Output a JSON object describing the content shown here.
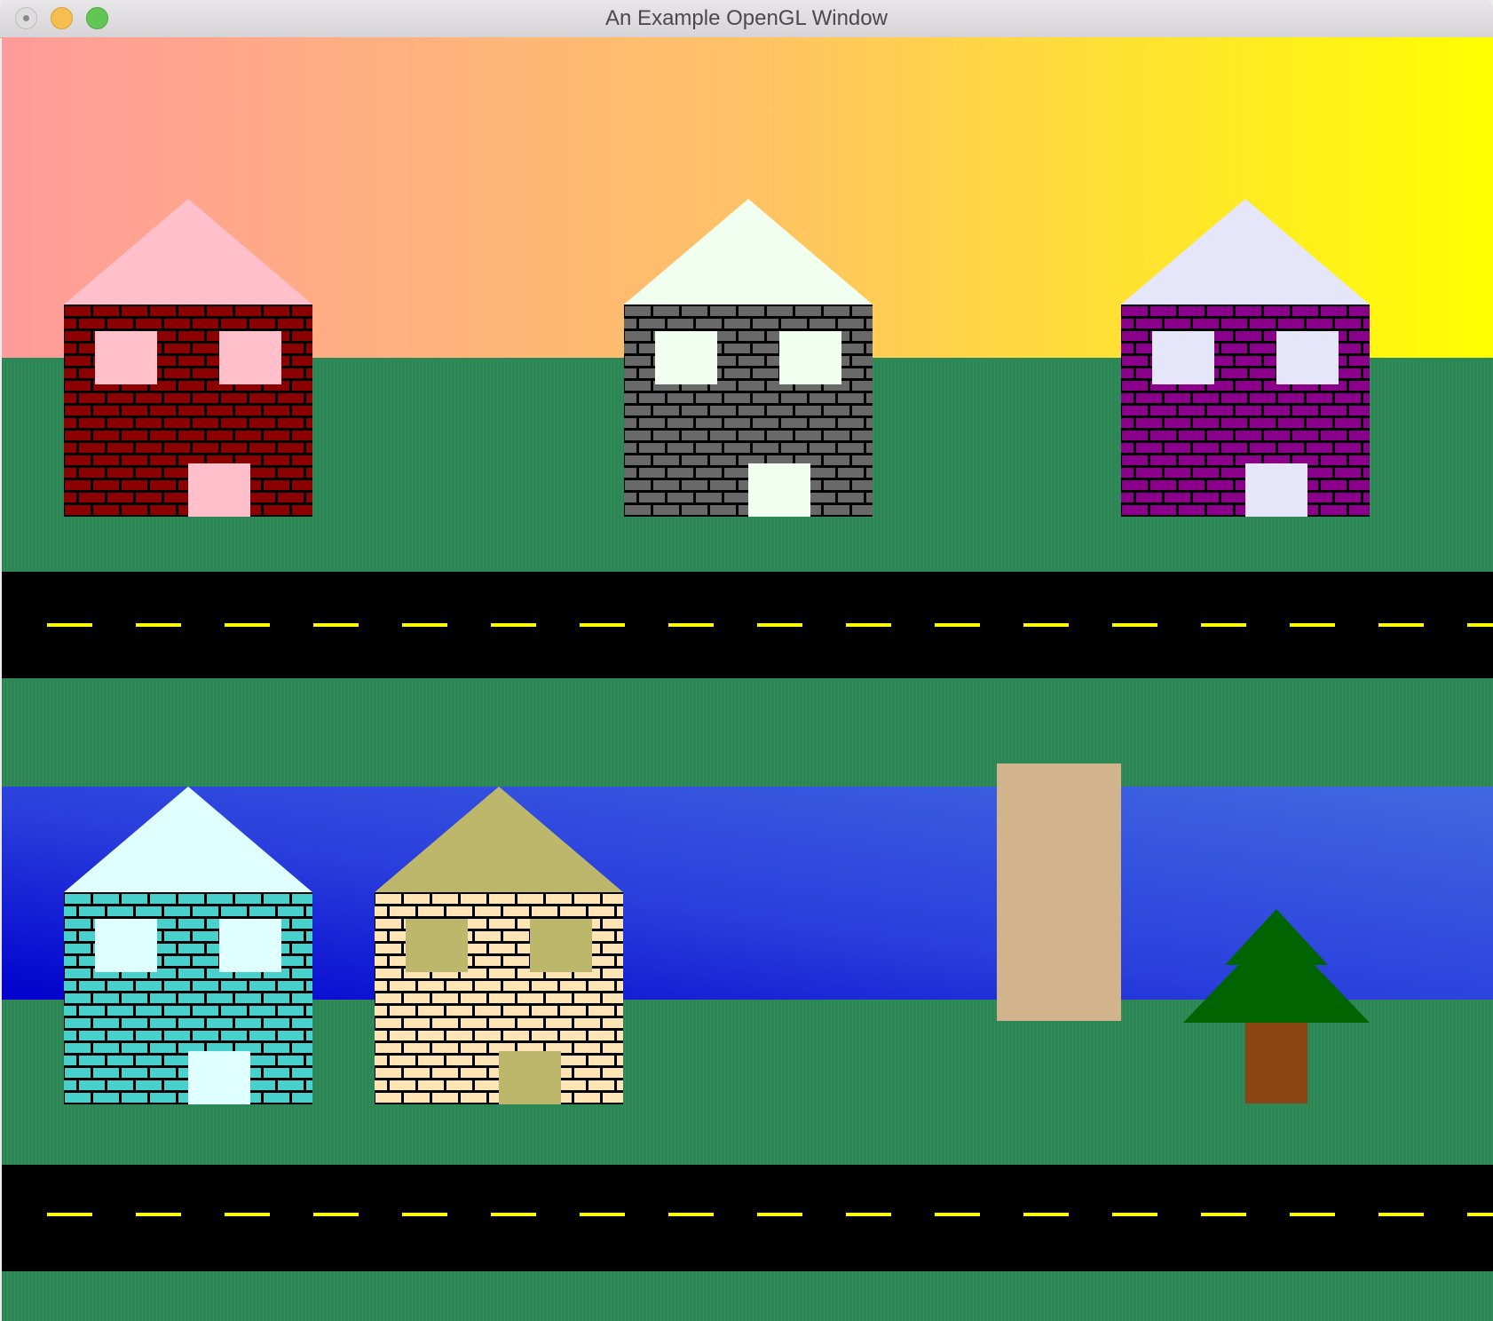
{
  "window": {
    "title": "An Example OpenGL Window"
  },
  "icons": [
    "close-button-icon",
    "minimize-button-icon",
    "zoom-button-icon"
  ],
  "colors": {
    "sky_left": "#ff9b9b",
    "sky_mid": "#ffc266",
    "sky_right": "#ffff00",
    "grass": "#2e8b57",
    "road": "#000000",
    "lane_line": "#ffff00",
    "river_left": "#0000cd",
    "river_mid": "#2a3fdc",
    "river_right": "#4169e1",
    "bridge": "#d2b48c",
    "tree_foliage": "#006400",
    "tree_trunk": "#8b4513"
  },
  "scene": {
    "houses": [
      {
        "name": "house-red",
        "wall": "#8b0000",
        "mortar": "#000000",
        "roof": "#ffc0cb",
        "trim": "#ffc0cb"
      },
      {
        "name": "house-gray",
        "wall": "#696969",
        "mortar": "#000000",
        "roof": "#f0fff0",
        "trim": "#f0fff0"
      },
      {
        "name": "house-purple",
        "wall": "#8b008b",
        "mortar": "#000000",
        "roof": "#e6e6fa",
        "trim": "#e6e6fa"
      },
      {
        "name": "house-turquoise",
        "wall": "#48d1cc",
        "mortar": "#000000",
        "roof": "#e0ffff",
        "trim": "#e0ffff"
      },
      {
        "name": "house-tan",
        "wall": "#ffe4b5",
        "mortar": "#000000",
        "roof": "#bdb76b",
        "trim": "#bdb76b"
      }
    ]
  }
}
